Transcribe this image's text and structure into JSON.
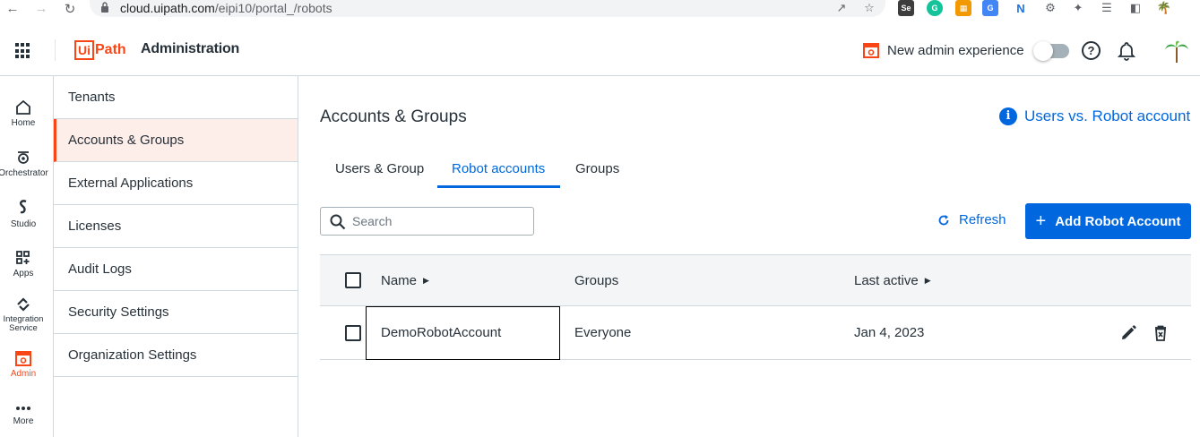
{
  "browser": {
    "url_host": "cloud.uipath.com",
    "url_path": "/eipi10/portal_/robots"
  },
  "header": {
    "logo_box": "Ui",
    "logo_path": "Path",
    "title": "Administration",
    "new_admin_label": "New admin experience",
    "toggle_on": false
  },
  "rail": {
    "items": [
      {
        "label": "Home"
      },
      {
        "label": "Orchestrator"
      },
      {
        "label": "Studio"
      },
      {
        "label": "Apps"
      },
      {
        "label": "Integration",
        "label2": "Service"
      },
      {
        "label": "Admin",
        "active": true
      },
      {
        "label": "More"
      }
    ]
  },
  "sidebar": {
    "items": [
      {
        "label": "Tenants"
      },
      {
        "label": "Accounts & Groups",
        "active": true
      },
      {
        "label": "External Applications"
      },
      {
        "label": "Licenses"
      },
      {
        "label": "Audit Logs"
      },
      {
        "label": "Security Settings"
      },
      {
        "label": "Organization Settings"
      }
    ]
  },
  "main": {
    "title": "Accounts & Groups",
    "info_link": "Users vs. Robot account",
    "tabs": [
      {
        "label": "Users & Group"
      },
      {
        "label": "Robot accounts",
        "active": true
      },
      {
        "label": "Groups"
      }
    ],
    "search_placeholder": "Search",
    "refresh_label": "Refresh",
    "add_label": "Add Robot Account"
  },
  "table": {
    "columns": [
      "Name",
      "Groups",
      "Last active"
    ],
    "rows": [
      {
        "name": "DemoRobotAccount",
        "groups": "Everyone",
        "last_active": "Jan 4, 2023"
      }
    ]
  },
  "colors": {
    "brand_orange": "#fa4616",
    "accent_blue": "#0067df",
    "text": "#273139"
  }
}
